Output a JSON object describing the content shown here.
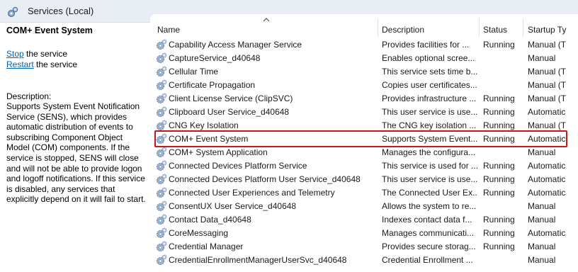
{
  "window": {
    "title": "Services (Local)",
    "icon": "services-gear-icon"
  },
  "leftpane": {
    "service_name": "COM+ Event System",
    "stop_link": "Stop",
    "stop_suffix": " the service",
    "restart_link": "Restart",
    "restart_suffix": " the service",
    "description_label": "Description:",
    "description": "Supports System Event Notification Service (SENS), which provides automatic distribution of events to subscribing Component Object Model (COM) components. If the service is stopped, SENS will close and will not be able to provide logon and logoff notifications. If this service is disabled, any services that explicitly depend on it will fail to start."
  },
  "table": {
    "columns": {
      "name": "Name",
      "description": "Description",
      "status": "Status",
      "startup": "Startup Ty"
    },
    "rows": [
      {
        "name": "Capability Access Manager Service",
        "description": "Provides facilities for ...",
        "status": "Running",
        "startup": "Manual (T"
      },
      {
        "name": "CaptureService_d40648",
        "description": "Enables optional scree...",
        "status": "",
        "startup": "Manual"
      },
      {
        "name": "Cellular Time",
        "description": "This service sets time b...",
        "status": "",
        "startup": "Manual (T"
      },
      {
        "name": "Certificate Propagation",
        "description": "Copies user certificates...",
        "status": "",
        "startup": "Manual (T"
      },
      {
        "name": "Client License Service (ClipSVC)",
        "description": "Provides infrastructure ...",
        "status": "Running",
        "startup": "Manual (T"
      },
      {
        "name": "Clipboard User Service_d40648",
        "description": "This user service is use...",
        "status": "Running",
        "startup": "Automatic"
      },
      {
        "name": "CNG Key Isolation",
        "description": "The CNG key isolation ...",
        "status": "Running",
        "startup": "Manual (T"
      },
      {
        "name": "COM+ Event System",
        "description": "Supports System Event...",
        "status": "Running",
        "startup": "Automatic"
      },
      {
        "name": "COM+ System Application",
        "description": "Manages the configura...",
        "status": "",
        "startup": "Manual"
      },
      {
        "name": "Connected Devices Platform Service",
        "description": "This service is used for ...",
        "status": "Running",
        "startup": "Automatic"
      },
      {
        "name": "Connected Devices Platform User Service_d40648",
        "description": "This user service is use...",
        "status": "Running",
        "startup": "Automatic"
      },
      {
        "name": "Connected User Experiences and Telemetry",
        "description": "The Connected User Ex...",
        "status": "Running",
        "startup": "Automatic"
      },
      {
        "name": "ConsentUX User Service_d40648",
        "description": "Allows the system to re...",
        "status": "",
        "startup": "Manual"
      },
      {
        "name": "Contact Data_d40648",
        "description": "Indexes contact data f...",
        "status": "Running",
        "startup": "Manual"
      },
      {
        "name": "CoreMessaging",
        "description": "Manages communicati...",
        "status": "Running",
        "startup": "Automatic"
      },
      {
        "name": "Credential Manager",
        "description": "Provides secure storag...",
        "status": "Running",
        "startup": "Manual"
      },
      {
        "name": "CredentialEnrollmentManagerUserSvc_d40648",
        "description": "Credential Enrollment ...",
        "status": "",
        "startup": "Manual"
      }
    ],
    "selected_index": 7
  },
  "colors": {
    "highlight": "#c8161d",
    "link": "#0063b1",
    "titlebar": "#e9eef5"
  }
}
